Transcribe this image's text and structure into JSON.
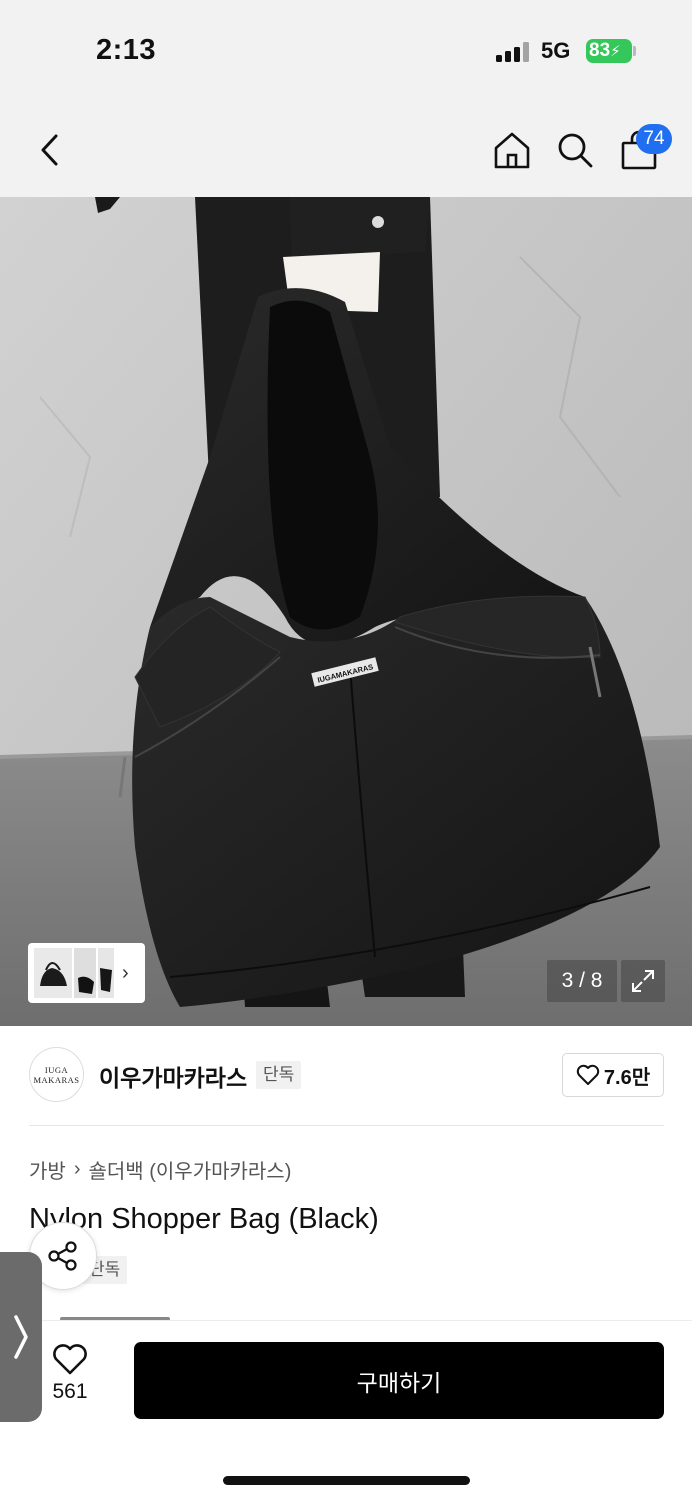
{
  "status_bar": {
    "time": "2:13",
    "network": "5G",
    "battery": "83"
  },
  "nav": {
    "cart_count": "74",
    "icons": [
      "chevron-left-icon",
      "home-icon",
      "search-icon",
      "bag-icon"
    ]
  },
  "gallery": {
    "page_counter": "3 / 8",
    "bag_logo_text": "IUGAMAKARAS"
  },
  "brand": {
    "logo_line1": "IUGA",
    "logo_line2": "MAKARAS",
    "name": "이우가마카라스",
    "tag": "단독",
    "likes": "7.6만"
  },
  "product": {
    "breadcrumb": [
      "가방",
      "숄더백 (이우가마카라스)"
    ],
    "title": "Nylon Shopper Bag (Black)",
    "exclusive_tag": "단독"
  },
  "bottom_bar": {
    "wish_count": "561",
    "buy_label": "구매하기"
  },
  "colors": {
    "accent_badge": "#1f6ff0",
    "battery": "#34c759",
    "buy_button": "#000000"
  }
}
